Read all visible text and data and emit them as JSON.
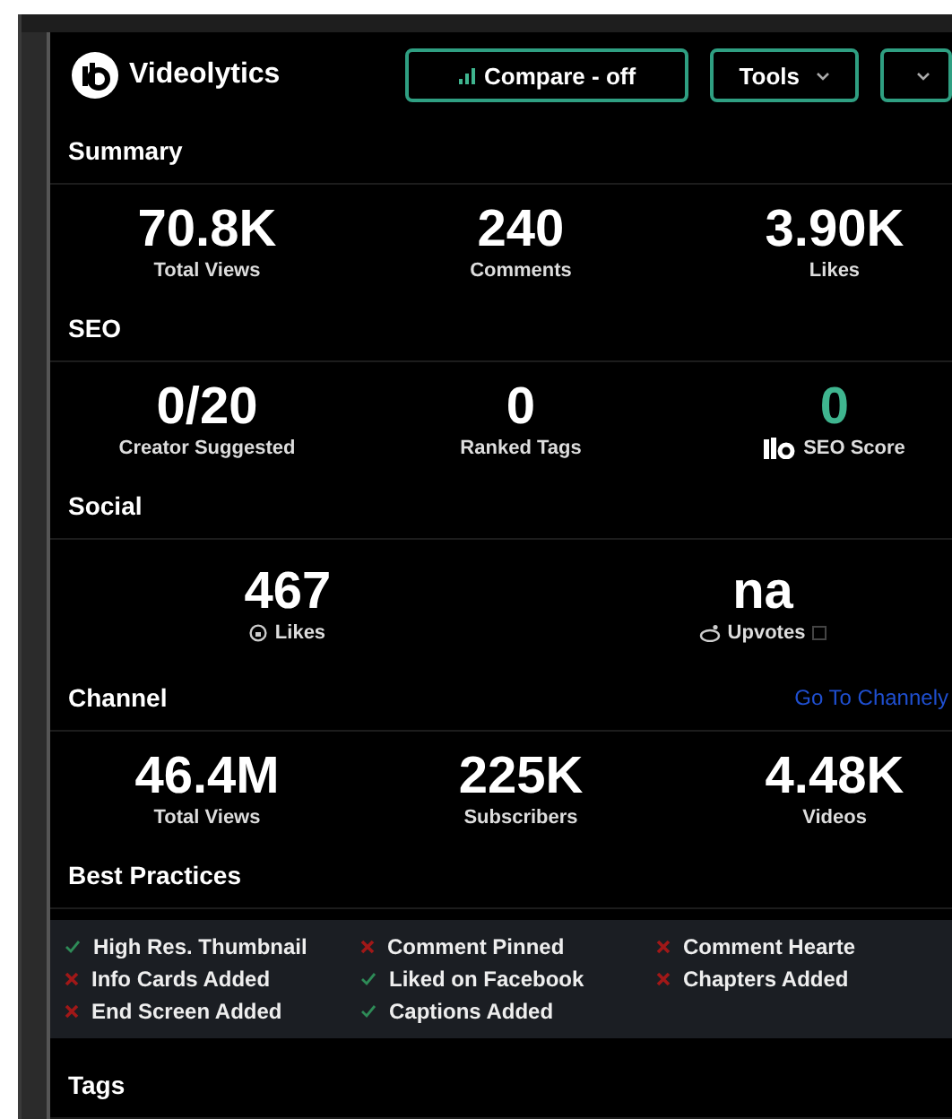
{
  "app": {
    "name": "Videolytics"
  },
  "toolbar": [
    {
      "kind": "toggle",
      "label": "Compare - off"
    },
    {
      "kind": "menu",
      "label": "Tools"
    },
    {
      "kind": "menu"
    }
  ],
  "sections": [
    {
      "title": "Summary",
      "kind": "stats",
      "stats": [
        {
          "kind": "plain",
          "value": "70.8K",
          "label": "Total Views"
        },
        {
          "kind": "plain",
          "value": "240",
          "label": "Comments"
        },
        {
          "kind": "plain",
          "value": "3.90K",
          "label": "Likes"
        }
      ]
    },
    {
      "title": "SEO",
      "kind": "stats",
      "stats": [
        {
          "kind": "plain",
          "value": "0/20",
          "label": "Creator Suggested"
        },
        {
          "kind": "plain",
          "value": "0",
          "label": "Ranked Tags"
        },
        {
          "kind": "score",
          "value": "0",
          "label": "SEO Score",
          "accent": true
        }
      ]
    },
    {
      "title": "Social",
      "kind": "pair",
      "stats": [
        {
          "kind": "likes",
          "value": "467",
          "label": "Likes"
        },
        {
          "kind": "upvotes",
          "value": "na",
          "label": "Upvotes"
        }
      ]
    },
    {
      "title": "Channel",
      "kind": "stats",
      "link": "Go To Channely",
      "stats": [
        {
          "kind": "plain",
          "value": "46.4M",
          "label": "Total Views"
        },
        {
          "kind": "plain",
          "value": "225K",
          "label": "Subscribers"
        },
        {
          "kind": "plain",
          "value": "4.48K",
          "label": "Videos"
        }
      ]
    },
    {
      "title": "Best Practices",
      "kind": "checklist",
      "items": [
        {
          "label": "High Res. Thumbnail",
          "done": true
        },
        {
          "label": "Comment Pinned",
          "done": false
        },
        {
          "label": "Comment Hearte",
          "done": false
        },
        {
          "label": "Info Cards Added",
          "done": false
        },
        {
          "label": "Liked on Facebook",
          "done": true
        },
        {
          "label": "Chapters Added",
          "done": false
        },
        {
          "label": "End Screen Added",
          "done": false
        },
        {
          "label": "Captions Added",
          "done": true
        }
      ]
    },
    {
      "title": "Tags",
      "kind": "empty"
    }
  ]
}
